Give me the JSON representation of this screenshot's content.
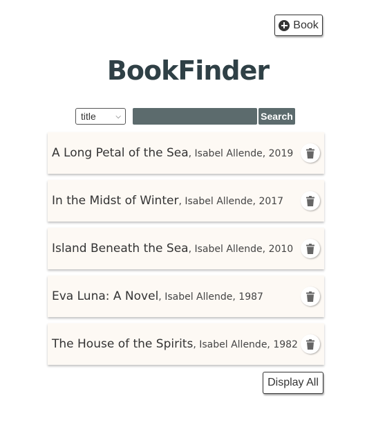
{
  "header": {
    "add_button_label": "Book",
    "add_button_icon": "plus-circle-icon",
    "app_title": "BookFinder"
  },
  "search": {
    "field_selected": "title",
    "query": "",
    "button_label": "Search"
  },
  "books": [
    {
      "title": "A Long Petal of the Sea",
      "meta": ", Isabel Allende, 2019"
    },
    {
      "title": "In the Midst of Winter",
      "meta": ", Isabel Allende, 2017"
    },
    {
      "title": "Island Beneath the Sea",
      "meta": ", Isabel Allende, 2010"
    },
    {
      "title": "Eva Luna: A Novel",
      "meta": ", Isabel Allende, 1987"
    },
    {
      "title": "The House of the Spirits",
      "meta": ", Isabel Allende, 1982"
    }
  ],
  "footer": {
    "display_all_label": "Display All"
  },
  "colors": {
    "card_background": "#fdf9f4",
    "search_background": "#5c6b6d",
    "title_color": "#2f4046"
  }
}
